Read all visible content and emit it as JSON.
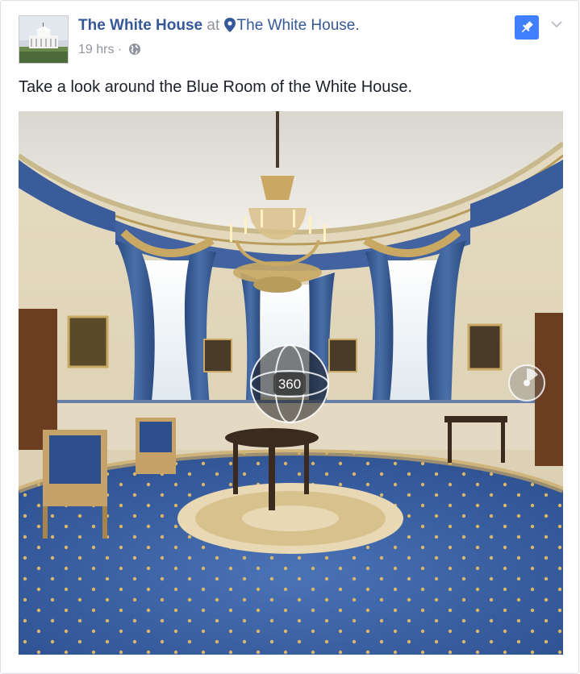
{
  "post": {
    "page_name": "The White House",
    "at_word": "at",
    "location": "The White House.",
    "time": "19 hrs",
    "separator": "·",
    "text": "Take a look around the Blue Room of the White House."
  },
  "badge_360": {
    "label": "360"
  },
  "icons": {
    "avatar": "white-house-avatar",
    "location": "location-pin-icon",
    "privacy": "globe-icon",
    "pin": "pushpin-icon",
    "menu": "chevron-down-icon",
    "compass": "compass-icon"
  },
  "colors": {
    "link": "#365899",
    "meta": "#90949c",
    "text": "#1d2129",
    "pin_button": "#4080ff",
    "carpet": "#3d64a8",
    "drapes": "#3a5c9a"
  }
}
